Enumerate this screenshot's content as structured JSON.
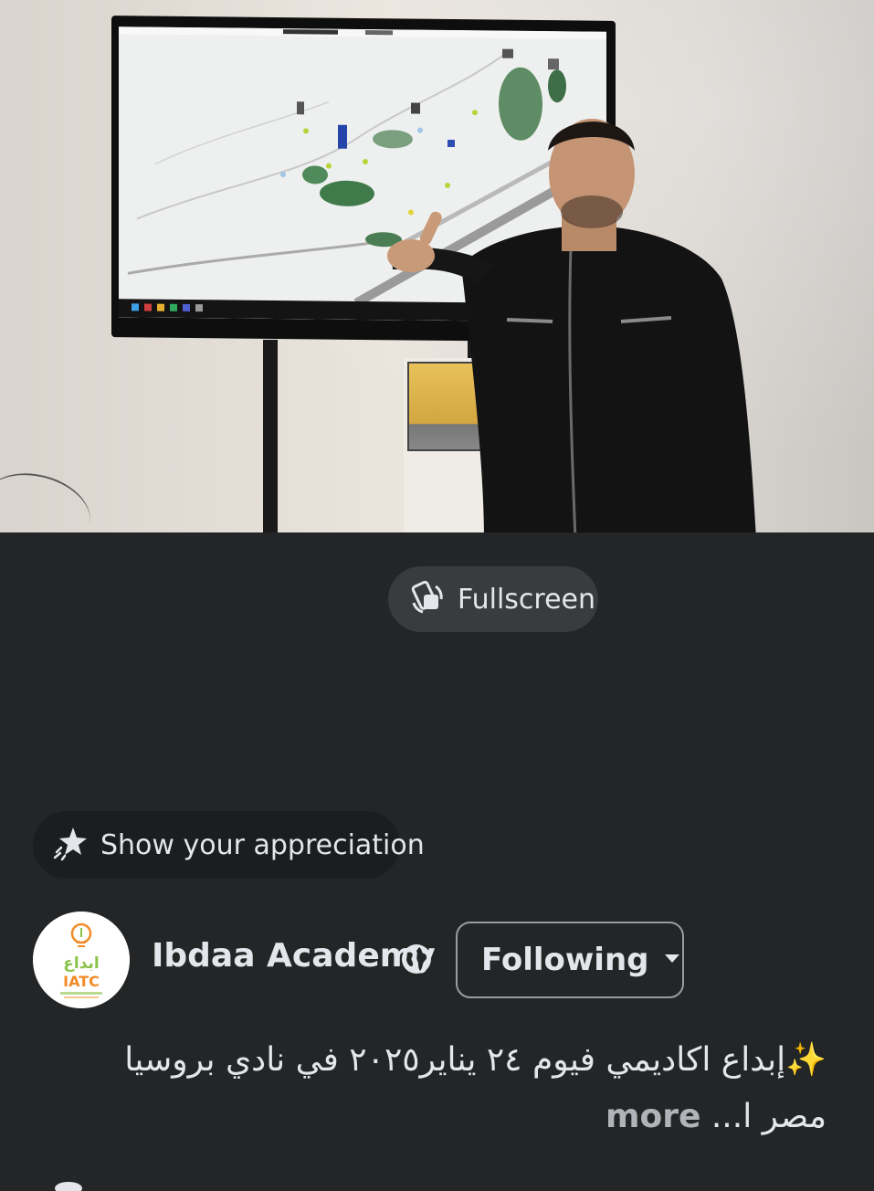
{
  "video": {
    "fullscreen_label": "Fullscreen"
  },
  "appreciation": {
    "label": "Show your appreciation",
    "icon": "sparkle-star-icon"
  },
  "page": {
    "name": "Ibdaa Academy",
    "avatar_text_ar": "ابداع",
    "avatar_text_en": "IATC",
    "privacy_icon": "globe-icon",
    "follow_label": "Following",
    "follow_icon": "caret-down-icon"
  },
  "post": {
    "caption_line1": "✨إبداع اكاديمي فيوم ٢٤ يناير٢٠٢٥ في نادي بروسيا",
    "caption_line2": "مصر ا...",
    "more_label": "more"
  },
  "colors": {
    "background": "#242526",
    "pill": "#3a3b3c",
    "text": "#e4e6eb",
    "logo_green": "#8bc34a",
    "logo_orange": "#f28c28"
  }
}
